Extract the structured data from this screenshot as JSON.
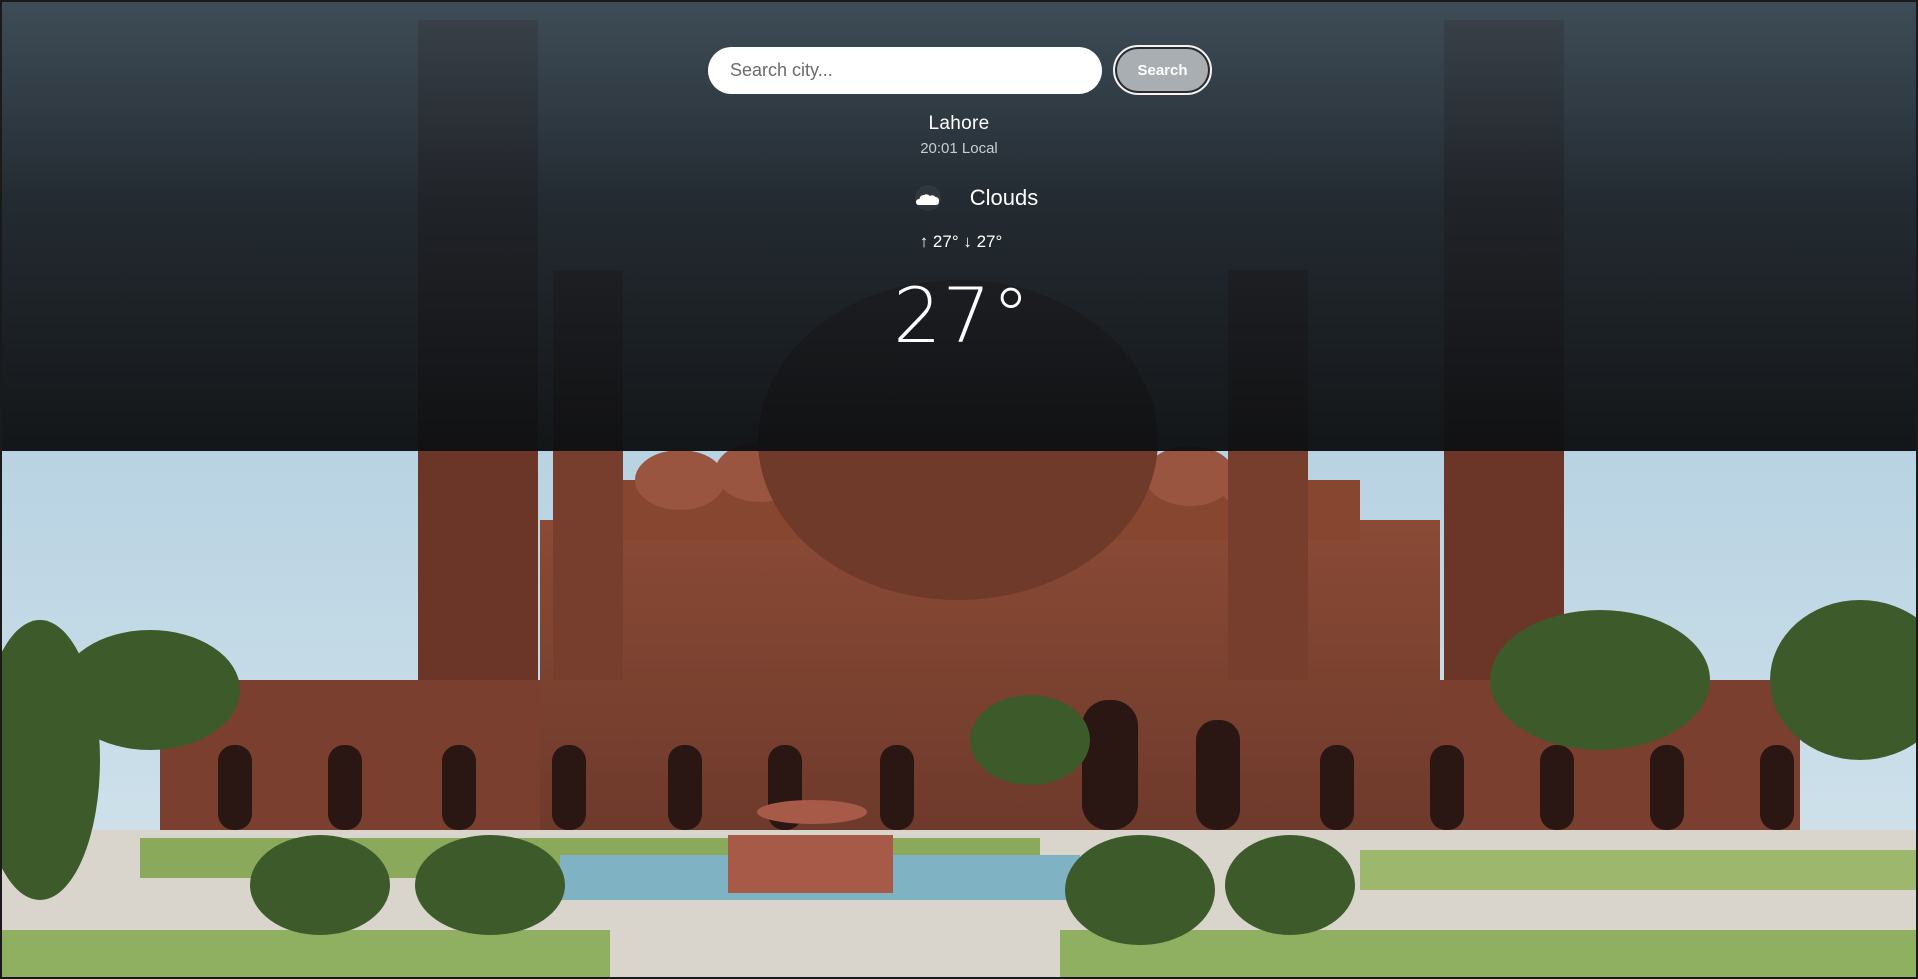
{
  "search": {
    "placeholder": "Search city...",
    "value": "",
    "button_label": "Search"
  },
  "weather": {
    "city": "Lahore",
    "local_time": "20:01 Local",
    "condition": "Clouds",
    "condition_icon": "cloud-icon",
    "minmax": "↑ 27° ↓ 27°",
    "temperature": "27°"
  },
  "colors": {
    "overlay_top": "#37444e",
    "overlay_bottom": "#0e1012",
    "text": "#ffffff",
    "button_bg": "#a9aeb3"
  }
}
